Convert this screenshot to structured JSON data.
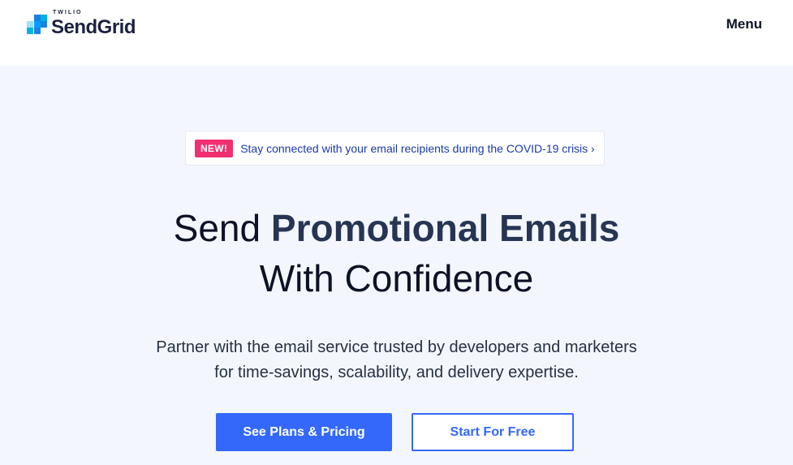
{
  "header": {
    "brand_small": "TWILIO",
    "brand_name": "SendGrid",
    "menu_label": "Menu"
  },
  "banner": {
    "badge": "NEW!",
    "text": "Stay connected with your email recipients during the COVID-19 crisis ›"
  },
  "hero": {
    "headline_lead": "Send ",
    "headline_strong": "Promotional Emails",
    "headline_line2": "With Confidence",
    "subtitle_line1": "Partner with the email service trusted by developers and marketers",
    "subtitle_line2": "for time-savings, scalability, and delivery expertise."
  },
  "buttons": {
    "primary": "See Plans & Pricing",
    "secondary": "Start For Free"
  },
  "colors": {
    "accent": "#3368fa",
    "badge": "#f22f6f",
    "hero_background": "#f3f7fd",
    "text_dark": "#0d1226"
  }
}
